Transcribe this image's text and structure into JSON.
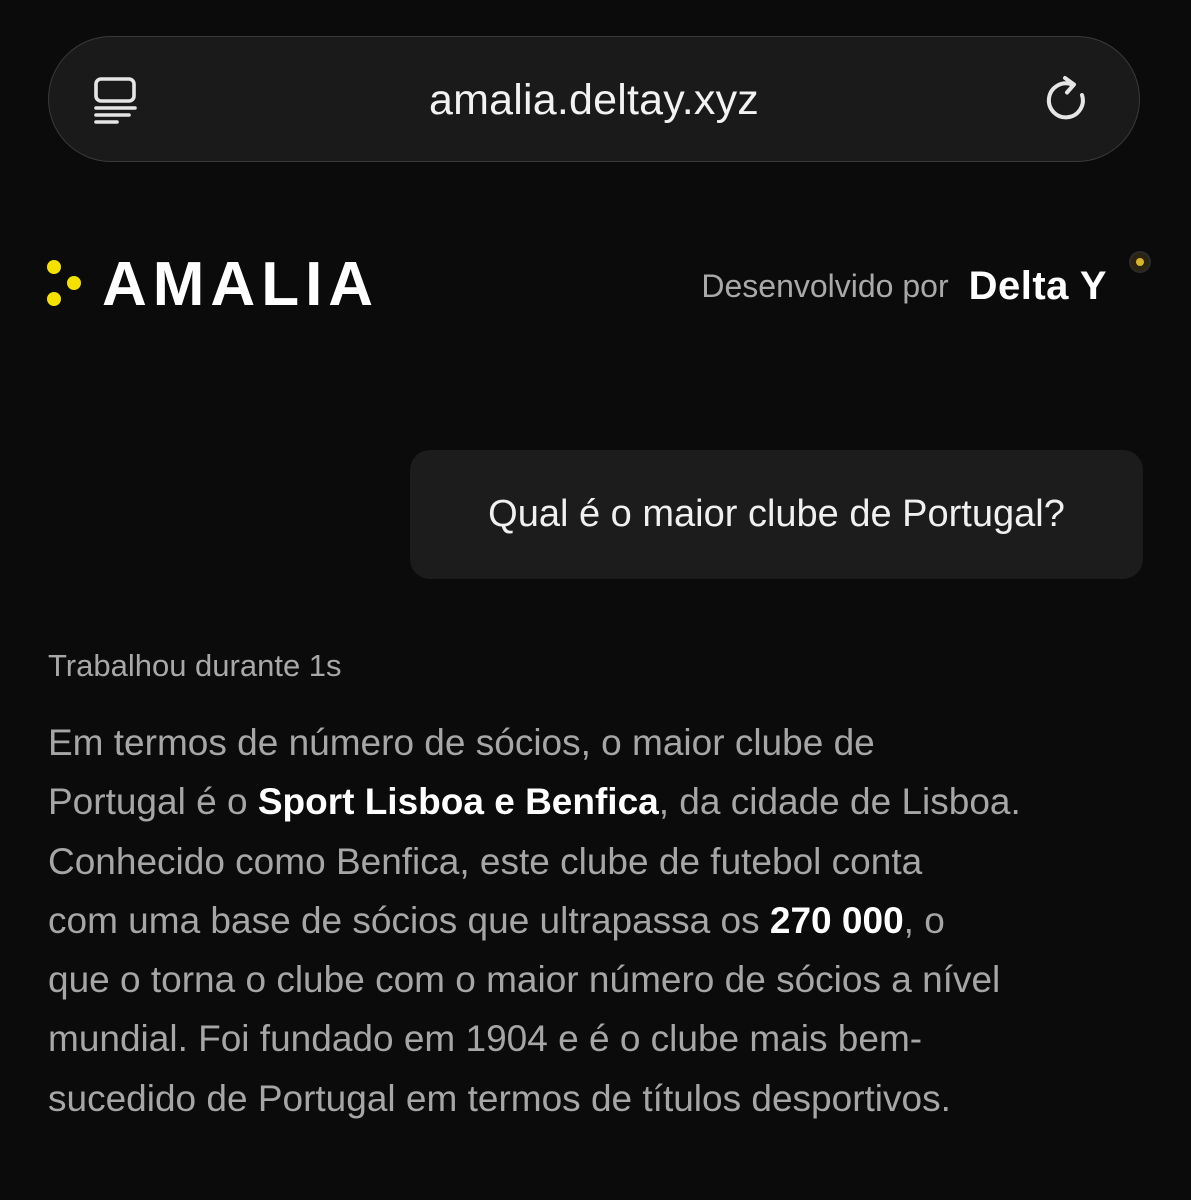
{
  "browser": {
    "url": "amalia.deltay.xyz",
    "reader_icon": "reader-mode-icon",
    "reload_icon": "reload-icon"
  },
  "header": {
    "brand_name": "AMALIA",
    "logo_icon": "three-dots-logo-icon",
    "developed_by_label": "Desenvolvido por",
    "developer_brand": "Delta Y",
    "accent_color": "#f5e100"
  },
  "chat": {
    "user_message": "Qual é o maior clube de Portugal?",
    "work_time": "Trabalhou durante 1s",
    "answer_lines": [
      [
        {
          "text": "Em termos de número de sócios, o maior clube de",
          "bold": false
        }
      ],
      [
        {
          "text": "Portugal é o ",
          "bold": false
        },
        {
          "text": "Sport Lisboa e Benfica",
          "bold": true
        },
        {
          "text": ", da cidade de Lisboa.",
          "bold": false
        }
      ],
      [
        {
          "text": "Conhecido como Benfica, este clube de futebol conta",
          "bold": false
        }
      ],
      [
        {
          "text": "com uma base de sócios que ultrapassa os ",
          "bold": false
        },
        {
          "text": "270 000",
          "bold": true
        },
        {
          "text": ", o",
          "bold": false
        }
      ],
      [
        {
          "text": "que o torna o clube com o maior número de sócios a nível",
          "bold": false
        }
      ],
      [
        {
          "text": "mundial. Foi fundado em 1904 e é o clube mais bem-",
          "bold": false
        }
      ],
      [
        {
          "text": "sucedido de Portugal em termos de títulos desportivos.",
          "bold": false
        }
      ]
    ]
  }
}
